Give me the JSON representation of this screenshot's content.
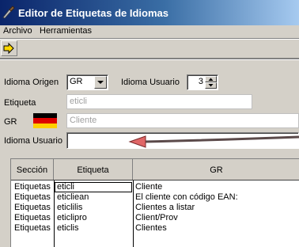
{
  "window": {
    "title": "Editor de Etiquetas de Idiomas"
  },
  "menu": {
    "items": [
      {
        "label": "Archivo"
      },
      {
        "label": "Herramientas"
      }
    ]
  },
  "toolbar": {
    "go_icon": "right-arrow-icon"
  },
  "form": {
    "idioma_origen_label": "Idioma Origen",
    "idioma_origen_value": "GR",
    "idioma_usuario_spin_label": "Idioma Usuario",
    "idioma_usuario_spin_value": "3",
    "etiqueta_label": "Etiqueta",
    "etiqueta_value": "eticli",
    "gr_label": "GR",
    "gr_value": "Cliente",
    "idioma_usuario_label": "Idioma Usuario",
    "idioma_usuario_value": ""
  },
  "grid": {
    "columns": [
      "Sección",
      "Etiqueta",
      "GR"
    ],
    "rows": [
      [
        "Etiquetas",
        "eticli",
        "Cliente"
      ],
      [
        "Etiquetas",
        "eticliean",
        "El cliente con código EAN:"
      ],
      [
        "Etiquetas",
        "eticlilis",
        "Clientes a listar"
      ],
      [
        "Etiquetas",
        "eticlipro",
        "Client/Prov"
      ],
      [
        "Etiquetas",
        "eticlis",
        "Clientes"
      ]
    ]
  },
  "colors": {
    "titlebar_start": "#0a246a",
    "titlebar_end": "#a6caf0",
    "annotation_arrow": "#5b4a4a"
  }
}
